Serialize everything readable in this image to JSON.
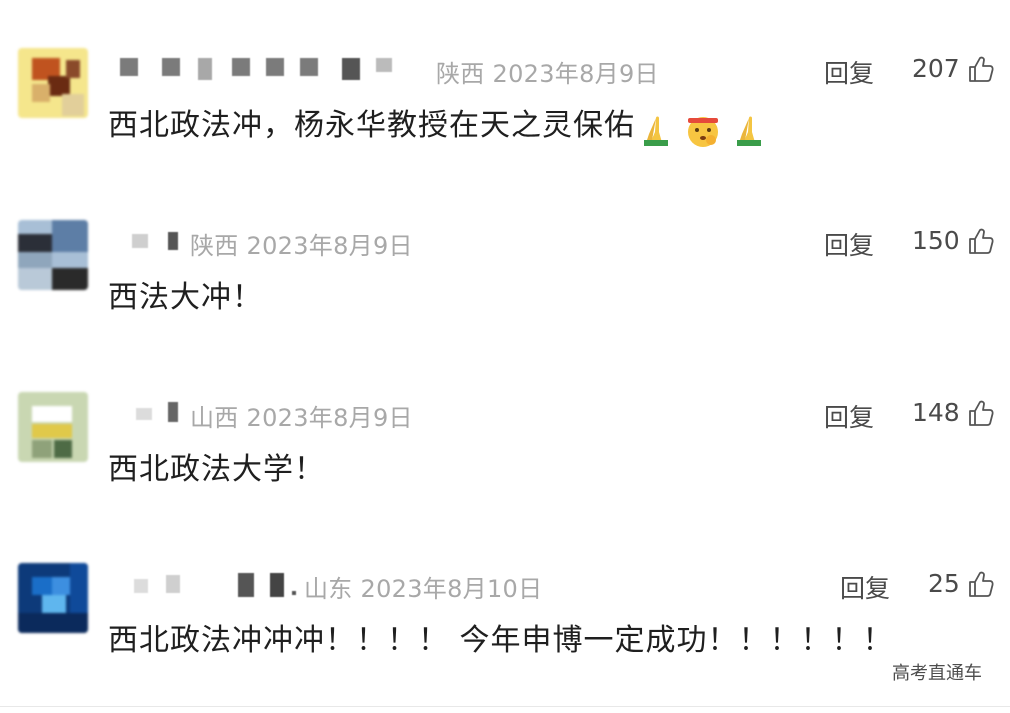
{
  "comments": [
    {
      "location_date": "陕西 2023年8月9日",
      "reply_label": "回复",
      "likes": "207",
      "text": "西北政法冲，杨永华教授在天之灵保佑",
      "emojis": [
        "folded-hands",
        "hushed-face",
        "folded-hands"
      ],
      "avatar_colors": [
        "#f5e68c",
        "#c0531f",
        "#6a2b12",
        "#d9b06a",
        "#8a4a2a",
        "#f2e8a0"
      ]
    },
    {
      "location_date": "陕西 2023年8月9日",
      "reply_label": "回复",
      "likes": "150",
      "text": "西法大冲！",
      "avatar_colors": [
        "#7a8aa0",
        "#2b2f38",
        "#5d7ea6",
        "#a8bfd6",
        "#2a2a2a",
        "#8fa6bc"
      ]
    },
    {
      "location_date": "山西 2023年8月9日",
      "reply_label": "回复",
      "likes": "148",
      "text": "西北政法大学！",
      "avatar_colors": [
        "#c9d7b2",
        "#ffffff",
        "#e0c94a",
        "#8fa27a",
        "#4e6b45",
        "#dfe6cf"
      ]
    },
    {
      "location_date": "山东 2023年8月10日",
      "reply_label": "回复",
      "likes": "25",
      "text": "西北政法冲冲冲！！！！ 今年申博一定成功！！！！！！",
      "avatar_colors": [
        "#0d3a7a",
        "#1a6ec8",
        "#5fb6ee",
        "#0b2a5c",
        "#3d8fe0",
        "#0f4a9a"
      ]
    }
  ],
  "watermark": "高考直通车",
  "colors": {
    "meta_gray": "#a8a8a8",
    "text": "#1f1f1f",
    "action_gray": "#4a4a4a"
  }
}
